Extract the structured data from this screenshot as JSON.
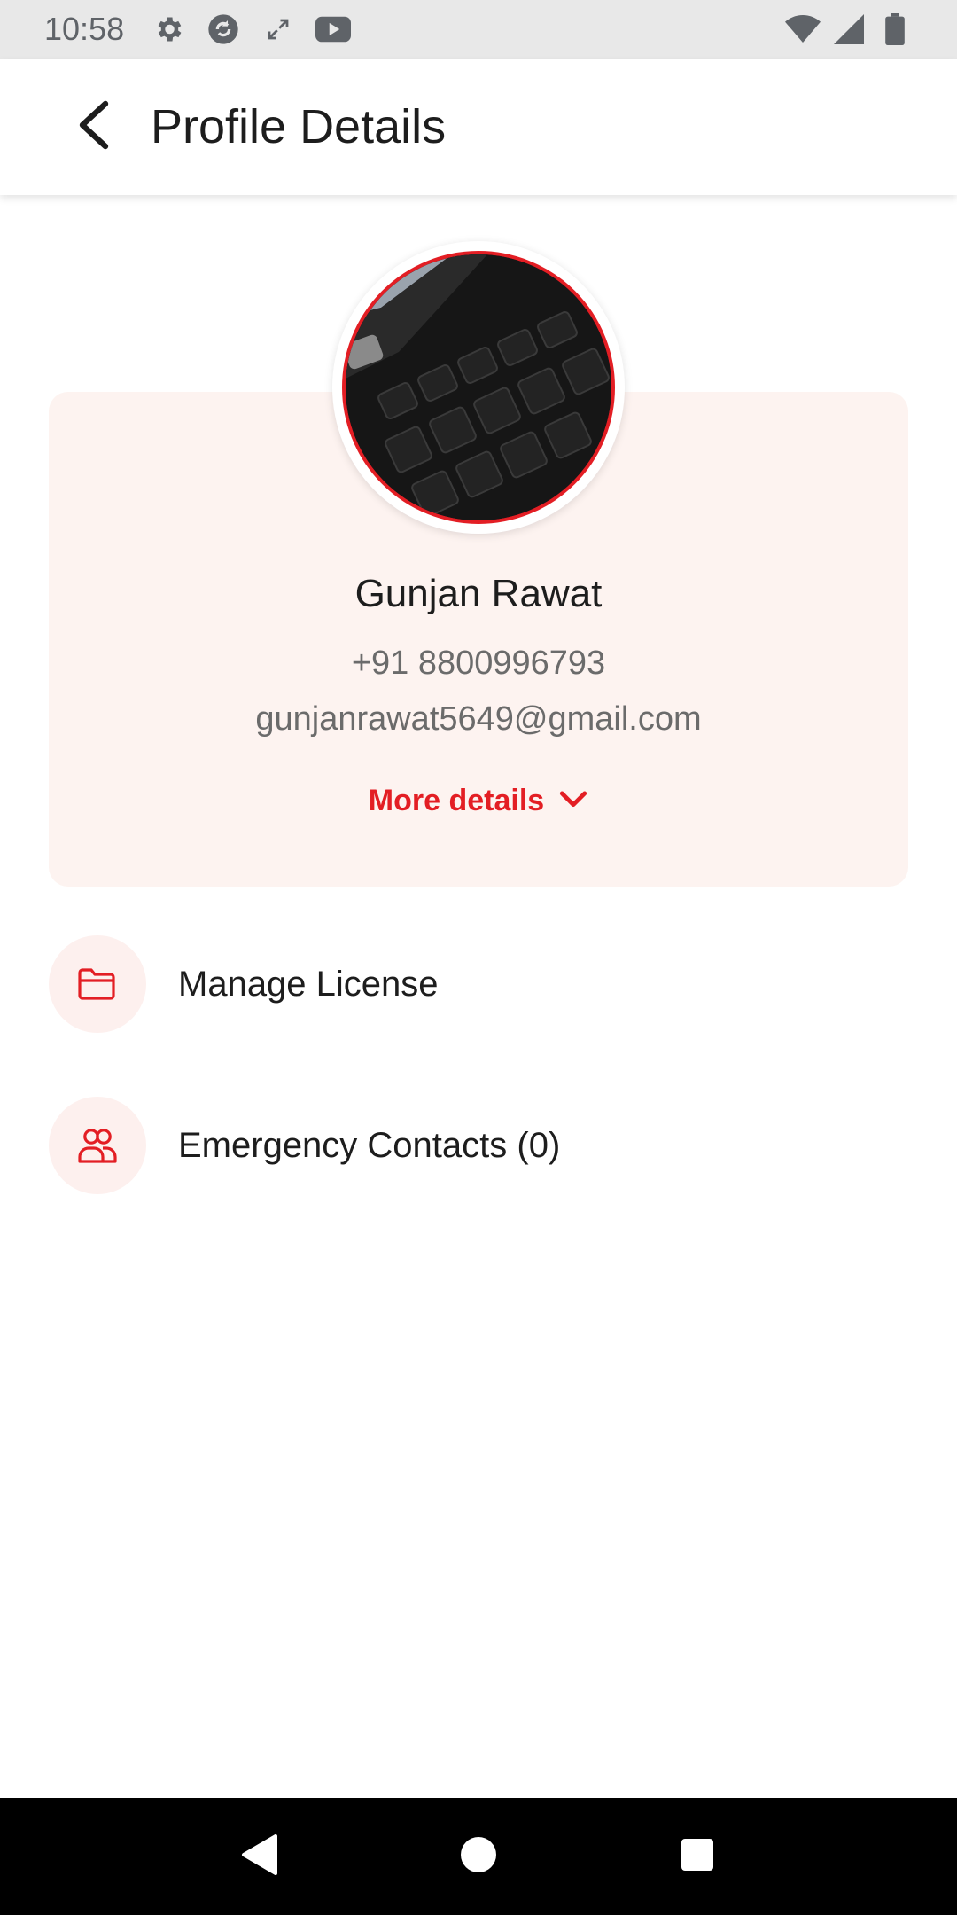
{
  "status_bar": {
    "time": "10:58",
    "left_icons": [
      "gear-icon",
      "sync-icon",
      "expand-icon",
      "youtube-icon"
    ],
    "right_icons": [
      "wifi-icon",
      "signal-icon",
      "battery-icon"
    ]
  },
  "app_bar": {
    "title": "Profile Details",
    "back_icon": "back-arrow-icon"
  },
  "profile": {
    "name": "Gunjan Rawat",
    "phone": "+91 8800996793",
    "email": "gunjanrawat5649@gmail.com",
    "more_details_label": "More details",
    "avatar_icon": "profile-photo"
  },
  "menu": {
    "items": [
      {
        "label": "Manage License",
        "icon": "folder-icon"
      },
      {
        "label": "Emergency Contacts (0)",
        "icon": "people-icon"
      }
    ]
  },
  "nav_bar": {
    "buttons": [
      "back-triangle-icon",
      "home-circle-icon",
      "recents-square-icon"
    ]
  },
  "colors": {
    "accent": "#e31e24",
    "card_background": "#fdf3f0",
    "status_bar": "#e8e8e8",
    "nav_bar": "#000000"
  }
}
